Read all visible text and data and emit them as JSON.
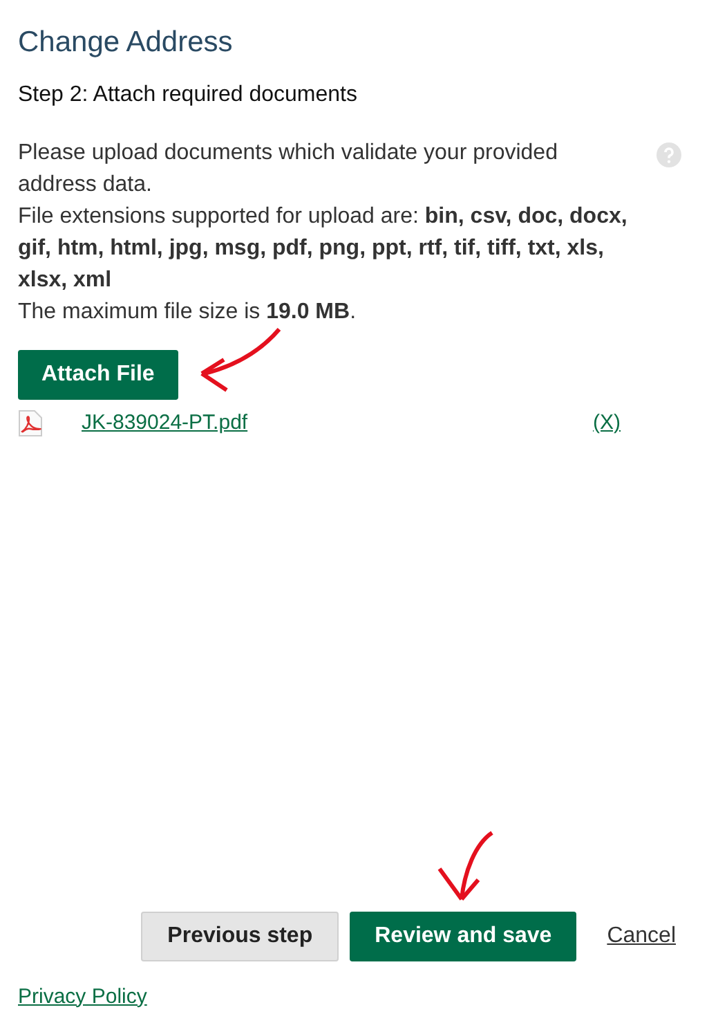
{
  "title": "Change Address",
  "step": "Step 2: Attach required documents",
  "instructions": [
    "Please upload documents which validate your provided address data.",
    "File extensions supported for upload are: **bin, csv, doc, docx, gif, htm, html, jpg, msg, pdf, png, ppt, rtf, tif, tiff, txt, xls, xlsx, xml**",
    "The maximum file size is **19.0 MB**."
  ],
  "attach_button": "Attach File",
  "files": [
    {
      "name": "JK-839024-PT.pdf",
      "remove": "(X)"
    }
  ],
  "buttons": [
    {
      "label": "Previous step",
      "kind": "secondary"
    },
    {
      "label": "Review and save",
      "kind": "primary"
    },
    {
      "label": "Cancel",
      "kind": "link"
    }
  ],
  "footer_link": "Privacy Policy"
}
